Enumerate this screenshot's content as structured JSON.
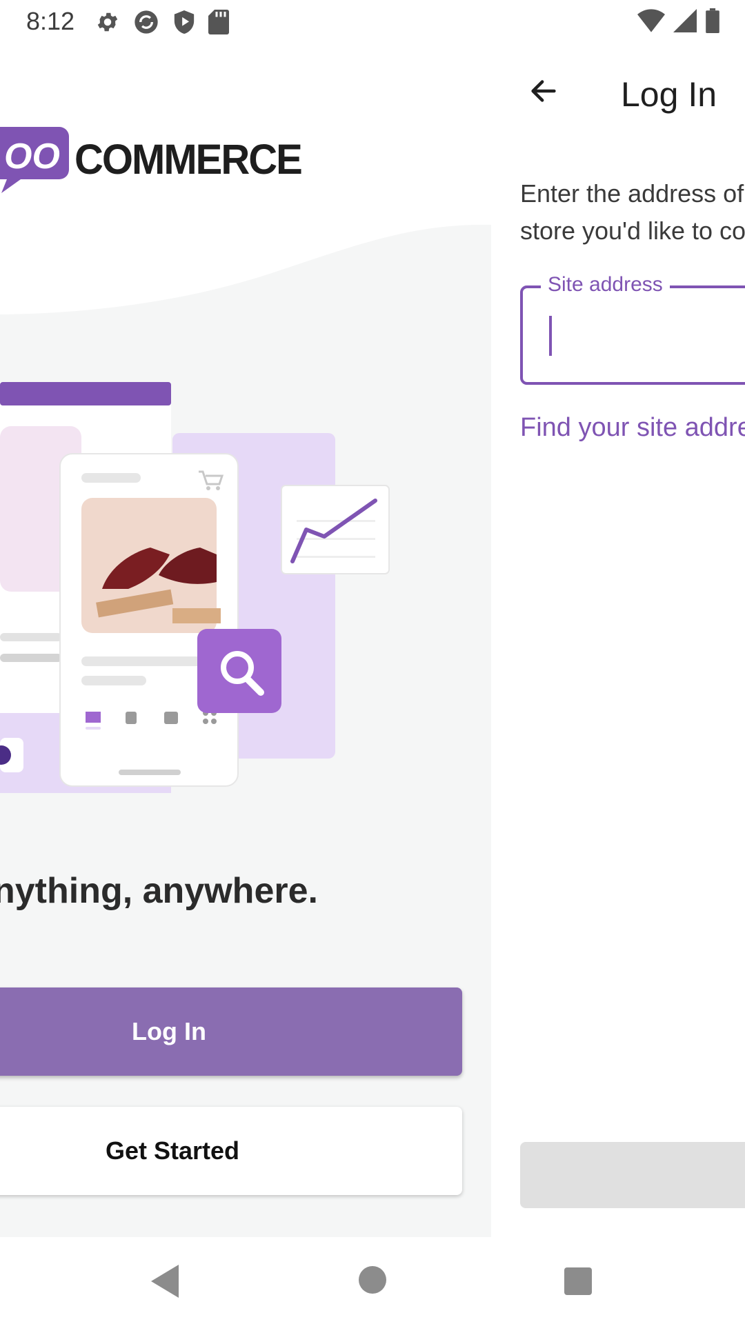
{
  "status_bar": {
    "time": "8:12",
    "left_icons": [
      "settings-icon",
      "sync-icon",
      "play-protect-icon",
      "sd-card-icon"
    ],
    "right_icons": [
      "wifi-icon",
      "cell-signal-icon",
      "battery-icon"
    ]
  },
  "welcome": {
    "logo_text": "COMMERCE",
    "logo_bubble_text": "OO",
    "tagline": "nything, anywhere.",
    "login_button": "Log In",
    "get_started_button": "Get Started"
  },
  "login": {
    "title": "Log In",
    "instructions": "Enter the address of your WooCommerce store you'd like to connect.",
    "site_field_label": "Site address",
    "site_field_value": "",
    "find_link": "Find your site address",
    "continue_button": ""
  },
  "colors": {
    "brand_purple": "#7f54b3",
    "button_purple": "#8a6db1",
    "panel_bg": "#f5f6f6"
  },
  "nav_bar": {
    "icons": [
      "back-icon",
      "home-icon",
      "recents-icon"
    ]
  }
}
